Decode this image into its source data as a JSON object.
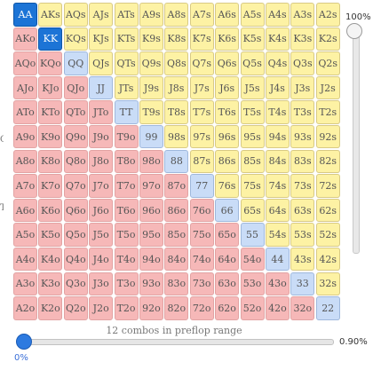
{
  "grid": {
    "rows": [
      [
        "AA",
        "AKs",
        "AQs",
        "AJs",
        "ATs",
        "A9s",
        "A8s",
        "A7s",
        "A6s",
        "A5s",
        "A4s",
        "A3s",
        "A2s"
      ],
      [
        "AKo",
        "KK",
        "KQs",
        "KJs",
        "KTs",
        "K9s",
        "K8s",
        "K7s",
        "K6s",
        "K5s",
        "K4s",
        "K3s",
        "K2s"
      ],
      [
        "AQo",
        "KQo",
        "QQ",
        "QJs",
        "QTs",
        "Q9s",
        "Q8s",
        "Q7s",
        "Q6s",
        "Q5s",
        "Q4s",
        "Q3s",
        "Q2s"
      ],
      [
        "AJo",
        "KJo",
        "QJo",
        "JJ",
        "JTs",
        "J9s",
        "J8s",
        "J7s",
        "J6s",
        "J5s",
        "J4s",
        "J3s",
        "J2s"
      ],
      [
        "ATo",
        "KTo",
        "QTo",
        "JTo",
        "TT",
        "T9s",
        "T8s",
        "T7s",
        "T6s",
        "T5s",
        "T4s",
        "T3s",
        "T2s"
      ],
      [
        "A9o",
        "K9o",
        "Q9o",
        "J9o",
        "T9o",
        "99",
        "98s",
        "97s",
        "96s",
        "95s",
        "94s",
        "93s",
        "92s"
      ],
      [
        "A8o",
        "K8o",
        "Q8o",
        "J8o",
        "T8o",
        "98o",
        "88",
        "87s",
        "86s",
        "85s",
        "84s",
        "83s",
        "82s"
      ],
      [
        "A7o",
        "K7o",
        "Q7o",
        "J7o",
        "T7o",
        "97o",
        "87o",
        "77",
        "76s",
        "75s",
        "74s",
        "73s",
        "72s"
      ],
      [
        "A6o",
        "K6o",
        "Q6o",
        "J6o",
        "T6o",
        "96o",
        "86o",
        "76o",
        "66",
        "65s",
        "64s",
        "63s",
        "62s"
      ],
      [
        "A5o",
        "K5o",
        "Q5o",
        "J5o",
        "T5o",
        "95o",
        "85o",
        "75o",
        "65o",
        "55",
        "54s",
        "53s",
        "52s"
      ],
      [
        "A4o",
        "K4o",
        "Q4o",
        "J4o",
        "T4o",
        "94o",
        "84o",
        "74o",
        "64o",
        "54o",
        "44",
        "43s",
        "42s"
      ],
      [
        "A3o",
        "K3o",
        "Q3o",
        "J3o",
        "T3o",
        "93o",
        "83o",
        "73o",
        "63o",
        "53o",
        "43o",
        "33",
        "32s"
      ],
      [
        "A2o",
        "K2o",
        "Q2o",
        "J2o",
        "T2o",
        "92o",
        "82o",
        "72o",
        "62o",
        "52o",
        "42o",
        "32o",
        "22"
      ]
    ],
    "selected": [
      "AA",
      "KK"
    ]
  },
  "colors": {
    "suited": "#fdf2a4",
    "offsuit": "#f6b8b8",
    "pair": "#c9dcf7",
    "selected": "#1c74d6"
  },
  "left_edge_chars": [
    "O",
    "TN"
  ],
  "vertical_slider": {
    "label": "100%",
    "level_percent": 100
  },
  "horizontal_slider": {
    "value_label": "0.90%",
    "min_label": "0%",
    "level_percent": 0.9
  },
  "status": {
    "combos_text": "12 combos in preflop range"
  }
}
